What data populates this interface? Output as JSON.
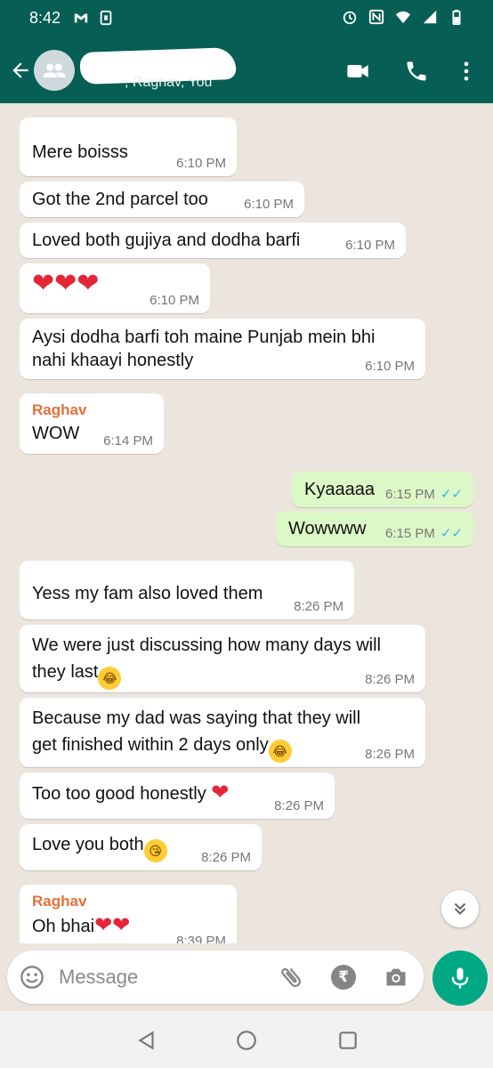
{
  "statusbar": {
    "time": "8:42",
    "left_icons": [
      "gmail-icon",
      "sim-icon"
    ],
    "right_icons": [
      "alarm-icon",
      "nfc-icon",
      "wifi-icon",
      "signal-icon",
      "battery-icon"
    ]
  },
  "header": {
    "subtitle": ", Raghav, You",
    "colors": {
      "bar": "#075e54"
    }
  },
  "messages": [
    {
      "sender": "",
      "text": "Mere boisss",
      "time": "6:10 PM"
    },
    {
      "text": "Got the 2nd parcel too",
      "time": "6:10 PM"
    },
    {
      "text": "Loved both gujiya and dodha barfi",
      "time": "6:10 PM"
    },
    {
      "text": "❤❤❤",
      "time": "6:10 PM"
    },
    {
      "text_line1": "Aysi dodha barfi toh maine Punjab mein bhi",
      "text_line2": "nahi khaayi honestly",
      "time": "6:10 PM"
    },
    {
      "sender": "Raghav",
      "text": "WOW",
      "time": "6:14 PM"
    },
    {
      "text": "Kyaaaaa",
      "time": "6:15 PM",
      "ticks": "✓✓"
    },
    {
      "text": "Wowwww",
      "time": "6:15 PM",
      "ticks": "✓✓"
    },
    {
      "text": "Yess my fam also loved them",
      "time": "8:26 PM"
    },
    {
      "text_line1": "We were just discussing how many days will",
      "text_line2": "they last",
      "time": "8:26 PM"
    },
    {
      "text_line1": "Because my dad was saying that they will",
      "text_line2": "get finished within 2 days only",
      "time": "8:26 PM"
    },
    {
      "text": "Too too good honestly",
      "time": "8:26 PM"
    },
    {
      "text": "Love you both",
      "time": "8:26 PM"
    },
    {
      "sender": "Raghav",
      "text": "Oh bhai",
      "time": "8:39 PM"
    }
  ],
  "input": {
    "placeholder": "Message",
    "rupee": "₹"
  }
}
